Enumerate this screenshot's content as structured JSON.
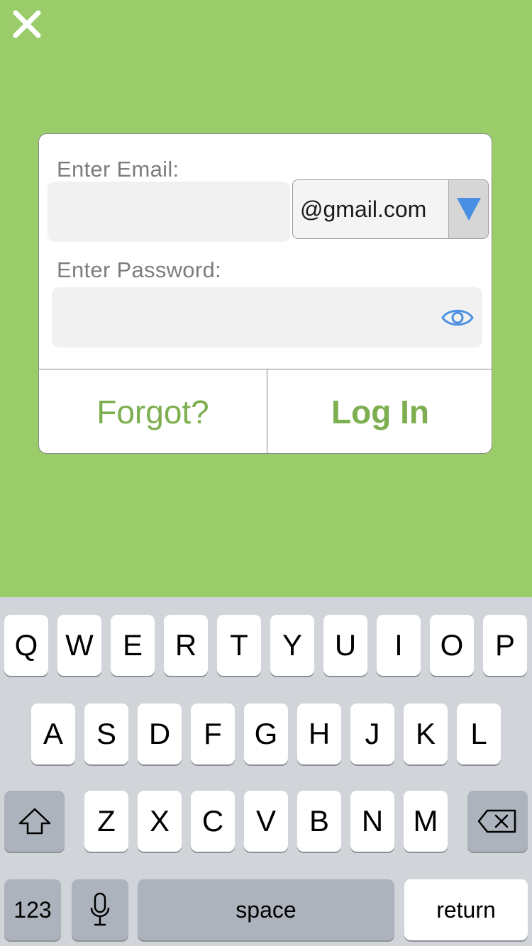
{
  "screen": {
    "background": "#9ACD6A",
    "accent": "#7DAE4F"
  },
  "login_form": {
    "email_label": "Enter Email:",
    "email_value": "",
    "domain_selected": "@gmail.com",
    "password_label": "Enter Password:",
    "password_value": "",
    "forgot_label": "Forgot?",
    "login_label": "Log In"
  },
  "icons": {
    "close": "close-icon",
    "dropdown": "triangle-down-icon",
    "show_password": "eye-icon",
    "shift": "shift-arrow-icon",
    "backspace": "backspace-icon",
    "dictation": "microphone-icon"
  },
  "keyboard": {
    "row1": [
      "Q",
      "W",
      "E",
      "R",
      "T",
      "Y",
      "U",
      "I",
      "O",
      "P"
    ],
    "row2": [
      "A",
      "S",
      "D",
      "F",
      "G",
      "H",
      "J",
      "K",
      "L"
    ],
    "row3": [
      "Z",
      "X",
      "C",
      "V",
      "B",
      "N",
      "M"
    ],
    "numbers_label": "123",
    "space_label": "space",
    "return_label": "return"
  }
}
